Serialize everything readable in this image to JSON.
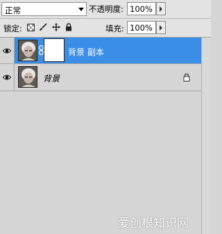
{
  "blend_mode": {
    "value": "正常",
    "arrow_icon": "chevron-down-icon"
  },
  "opacity": {
    "label": "不透明度:",
    "value": "100%"
  },
  "lock": {
    "label": "锁定:"
  },
  "fill": {
    "label": "填充:",
    "value": "100%"
  },
  "layers": [
    {
      "name": "背景 副本",
      "selected": true,
      "visible": true,
      "has_mask": true,
      "locked": false
    },
    {
      "name": "背景",
      "selected": false,
      "visible": true,
      "has_mask": false,
      "locked": true
    }
  ],
  "watermark": "爱创根知识网",
  "colors": {
    "selection": "#3a8ee6",
    "panel": "#d6d6d6",
    "toolbar": "#e3e3e3"
  }
}
